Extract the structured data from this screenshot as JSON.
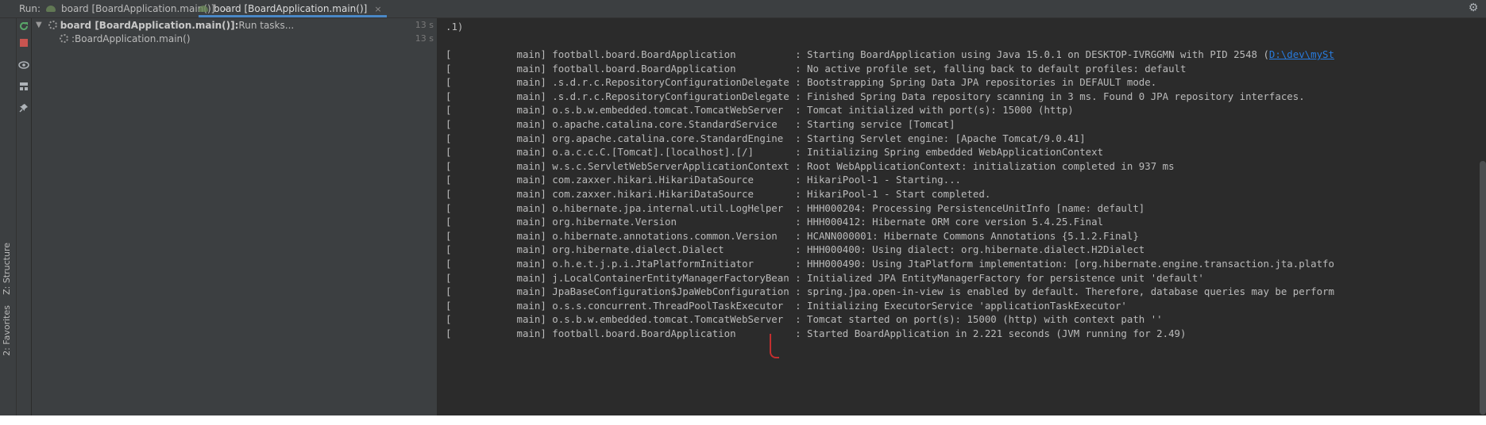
{
  "run_label": "Run:",
  "tabs": [
    {
      "label": "board [BoardApplication.main()]",
      "close": "×"
    },
    {
      "label": "board [BoardApplication.main()]",
      "close": "×"
    }
  ],
  "left_stripe": {
    "structure": "Z: Structure",
    "favorites": "2: Favorites"
  },
  "tree": {
    "root_label": "board [BoardApplication.main()]:",
    "root_status": " Run tasks...",
    "root_time": "13 s",
    "child_label": ":BoardApplication.main()",
    "child_time": "13 s"
  },
  "console": {
    "header": ".1)",
    "lines": [
      {
        "prefix": "[           main] football.board.BoardApplication          : Starting BoardApplication using Java 15.0.1 on DESKTOP-IVRGGMN with PID 2548 (",
        "link": "D:\\dev\\mySt"
      },
      {
        "prefix": "[           main] football.board.BoardApplication          : No active profile set, falling back to default profiles: default"
      },
      {
        "prefix": "[           main] .s.d.r.c.RepositoryConfigurationDelegate : Bootstrapping Spring Data JPA repositories in DEFAULT mode."
      },
      {
        "prefix": "[           main] .s.d.r.c.RepositoryConfigurationDelegate : Finished Spring Data repository scanning in 3 ms. Found 0 JPA repository interfaces."
      },
      {
        "prefix": "[           main] o.s.b.w.embedded.tomcat.TomcatWebServer  : Tomcat initialized with port(s): 15000 (http)"
      },
      {
        "prefix": "[           main] o.apache.catalina.core.StandardService   : Starting service [Tomcat]"
      },
      {
        "prefix": "[           main] org.apache.catalina.core.StandardEngine  : Starting Servlet engine: [Apache Tomcat/9.0.41]"
      },
      {
        "prefix": "[           main] o.a.c.c.C.[Tomcat].[localhost].[/]       : Initializing Spring embedded WebApplicationContext"
      },
      {
        "prefix": "[           main] w.s.c.ServletWebServerApplicationContext : Root WebApplicationContext: initialization completed in 937 ms"
      },
      {
        "prefix": "[           main] com.zaxxer.hikari.HikariDataSource       : HikariPool-1 - Starting..."
      },
      {
        "prefix": "[           main] com.zaxxer.hikari.HikariDataSource       : HikariPool-1 - Start completed."
      },
      {
        "prefix": "[           main] o.hibernate.jpa.internal.util.LogHelper  : HHH000204: Processing PersistenceUnitInfo [name: default]"
      },
      {
        "prefix": "[           main] org.hibernate.Version                    : HHH000412: Hibernate ORM core version 5.4.25.Final"
      },
      {
        "prefix": "[           main] o.hibernate.annotations.common.Version   : HCANN000001: Hibernate Commons Annotations {5.1.2.Final}"
      },
      {
        "prefix": "[           main] org.hibernate.dialect.Dialect            : HHH000400: Using dialect: org.hibernate.dialect.H2Dialect"
      },
      {
        "prefix": "[           main] o.h.e.t.j.p.i.JtaPlatformInitiator       : HHH000490: Using JtaPlatform implementation: [org.hibernate.engine.transaction.jta.platfo"
      },
      {
        "prefix": "[           main] j.LocalContainerEntityManagerFactoryBean : Initialized JPA EntityManagerFactory for persistence unit 'default'"
      },
      {
        "prefix": "[           main] JpaBaseConfiguration$JpaWebConfiguration : spring.jpa.open-in-view is enabled by default. Therefore, database queries may be perform"
      },
      {
        "prefix": "[           main] o.s.s.concurrent.ThreadPoolTaskExecutor  : Initializing ExecutorService 'applicationTaskExecutor'"
      },
      {
        "prefix": "[           main] o.s.b.w.embedded.tomcat.TomcatWebServer  : Tomcat started on port(s): 15000 (http) with context path ''"
      },
      {
        "prefix": "[           main] football.board.BoardApplication          : Started BoardApplication in 2.221 seconds (JVM running for 2.49)"
      }
    ]
  },
  "colors": {
    "accent": "#4a88c7",
    "link": "#287bde",
    "rerun": "#59a869",
    "stop": "#c75450"
  }
}
